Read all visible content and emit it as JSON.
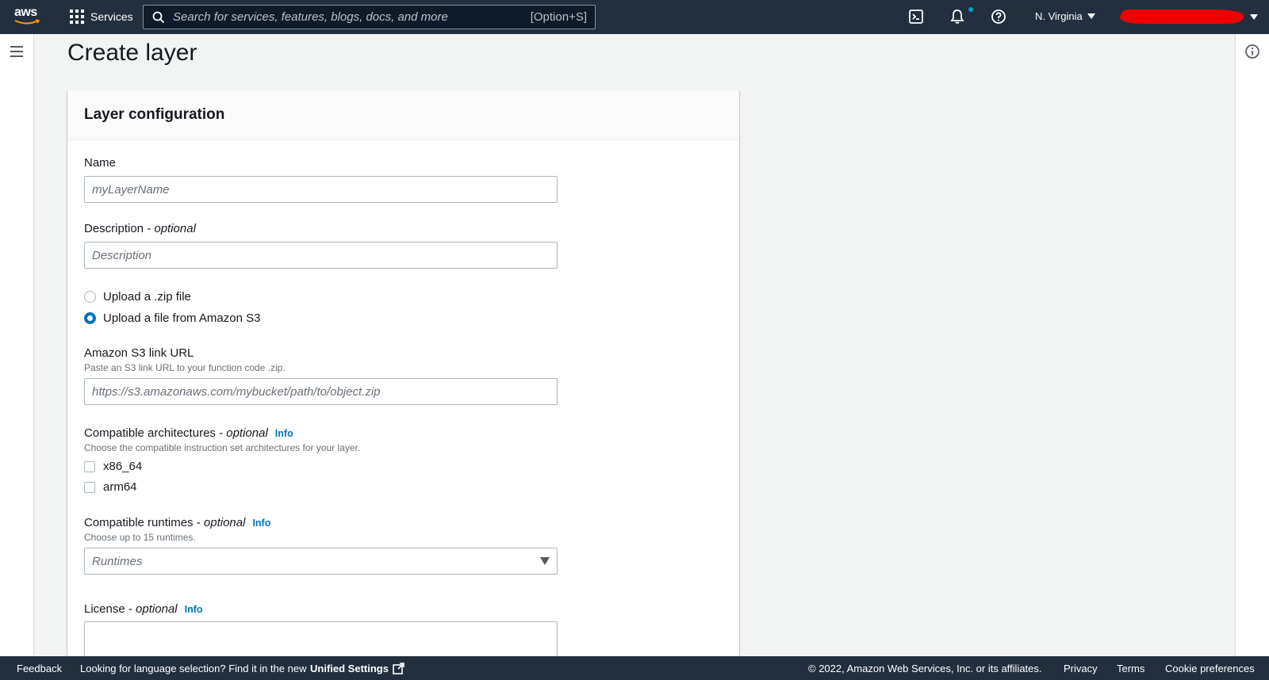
{
  "nav": {
    "logo_text": "aws",
    "services_label": "Services",
    "search_placeholder": "Search for services, features, blogs, docs, and more",
    "search_shortcut": "[Option+S]",
    "region": "N. Virginia",
    "icons": [
      "cloudshell-icon",
      "bell-icon",
      "help-icon"
    ]
  },
  "page": {
    "title": "Create layer"
  },
  "panel": {
    "header": "Layer configuration",
    "name": {
      "label": "Name",
      "placeholder": "myLayerName"
    },
    "description": {
      "label": "Description - ",
      "optional": "optional",
      "placeholder": "Description"
    },
    "upload_options": [
      {
        "label": "Upload a .zip file",
        "selected": false
      },
      {
        "label": "Upload a file from Amazon S3",
        "selected": true
      }
    ],
    "s3_url": {
      "label": "Amazon S3 link URL",
      "hint": "Paste an S3 link URL to your function code .zip.",
      "placeholder": "https://s3.amazonaws.com/mybucket/path/to/object.zip"
    },
    "architectures": {
      "label": "Compatible architectures - ",
      "optional": "optional",
      "info": "Info",
      "hint": "Choose the compatible instruction set architectures for your layer.",
      "options": [
        "x86_64",
        "arm64"
      ]
    },
    "runtimes": {
      "label": "Compatible runtimes - ",
      "optional": "optional",
      "info": "Info",
      "hint": "Choose up to 15 runtimes.",
      "placeholder": "Runtimes"
    },
    "license": {
      "label": "License - ",
      "optional": "optional",
      "info": "Info"
    }
  },
  "footer": {
    "feedback": "Feedback",
    "language_text": "Looking for language selection? Find it in the new",
    "unified_settings": "Unified Settings",
    "copyright": "© 2022, Amazon Web Services, Inc. or its affiliates.",
    "privacy": "Privacy",
    "terms": "Terms",
    "cookie": "Cookie preferences"
  },
  "colors": {
    "nav_bg": "#232f3e",
    "link": "#0073bb",
    "radio_selected": "#0073bb",
    "notification_dot": "#00a1c9"
  }
}
